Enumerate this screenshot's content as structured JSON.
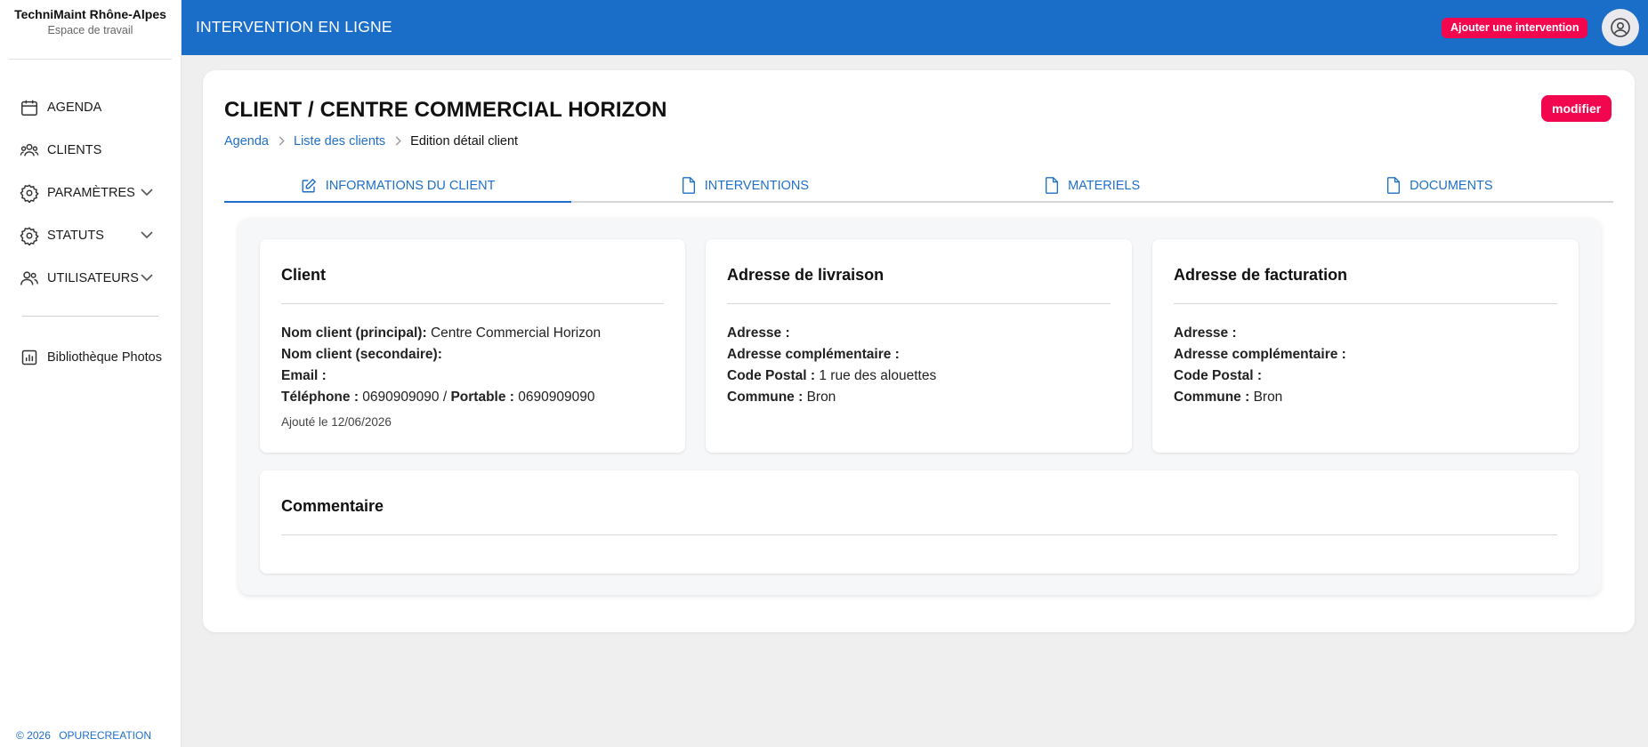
{
  "sidebar": {
    "brand_name": "TechniMaint Rhône-Alpes",
    "brand_sub": "Espace de travail",
    "items": [
      {
        "label": "AGENDA",
        "icon": "calendar-icon"
      },
      {
        "label": "CLIENTS",
        "icon": "users-icon"
      },
      {
        "label": "PARAMÈTRES",
        "icon": "gear-icon",
        "expandable": true
      },
      {
        "label": "STATUTS",
        "icon": "gear-icon",
        "expandable": true
      },
      {
        "label": "UTILISATEURS",
        "icon": "user-group-icon",
        "expandable": true
      }
    ],
    "photos_label": "Bibliothèque Photos",
    "footer_year": "© 2026",
    "footer_company": "OPURECREATION"
  },
  "topbar": {
    "title": "INTERVENTION EN LIGNE",
    "add_label": "Ajouter une intervention"
  },
  "page": {
    "title": "CLIENT / CENTRE COMMERCIAL HORIZON",
    "modify_label": "modifier",
    "breadcrumb": [
      "Agenda",
      "Liste des clients",
      "Edition détail client"
    ]
  },
  "tabs": [
    {
      "label": "INFORMATIONS DU CLIENT",
      "icon": "edit-icon",
      "active": true
    },
    {
      "label": "INTERVENTIONS",
      "icon": "document-icon",
      "active": false
    },
    {
      "label": "MATERIELS",
      "icon": "document-icon",
      "active": false
    },
    {
      "label": "DOCUMENTS",
      "icon": "document-icon",
      "active": false
    }
  ],
  "client": {
    "title": "Client",
    "name_primary_label": "Nom client (principal):",
    "name_primary": "Centre Commercial Horizon",
    "name_secondary_label": "Nom client (secondaire):",
    "name_secondary": "",
    "email_label": "Email :",
    "email": "",
    "phone_label": "Téléphone :",
    "phone": "0690909090",
    "phone_sep": "/",
    "mobile_label": "Portable :",
    "mobile": "0690909090",
    "added": "Ajouté le 12/06/2026"
  },
  "delivery": {
    "title": "Adresse de livraison",
    "address_label": "Adresse :",
    "address": "",
    "complement_label": "Adresse complémentaire :",
    "complement": "",
    "postal_label": "Code Postal :",
    "postal": "1 rue des alouettes",
    "city_label": "Commune :",
    "city": "Bron"
  },
  "billing": {
    "title": "Adresse de facturation",
    "address_label": "Adresse :",
    "address": "",
    "complement_label": "Adresse complémentaire :",
    "complement": "",
    "postal_label": "Code Postal :",
    "postal": "",
    "city_label": "Commune :",
    "city": "Bron"
  },
  "comment": {
    "title": "Commentaire",
    "text": ""
  },
  "colors": {
    "primary": "#1b6ec8",
    "accent": "#f2074f",
    "link": "#1f6fc9"
  }
}
